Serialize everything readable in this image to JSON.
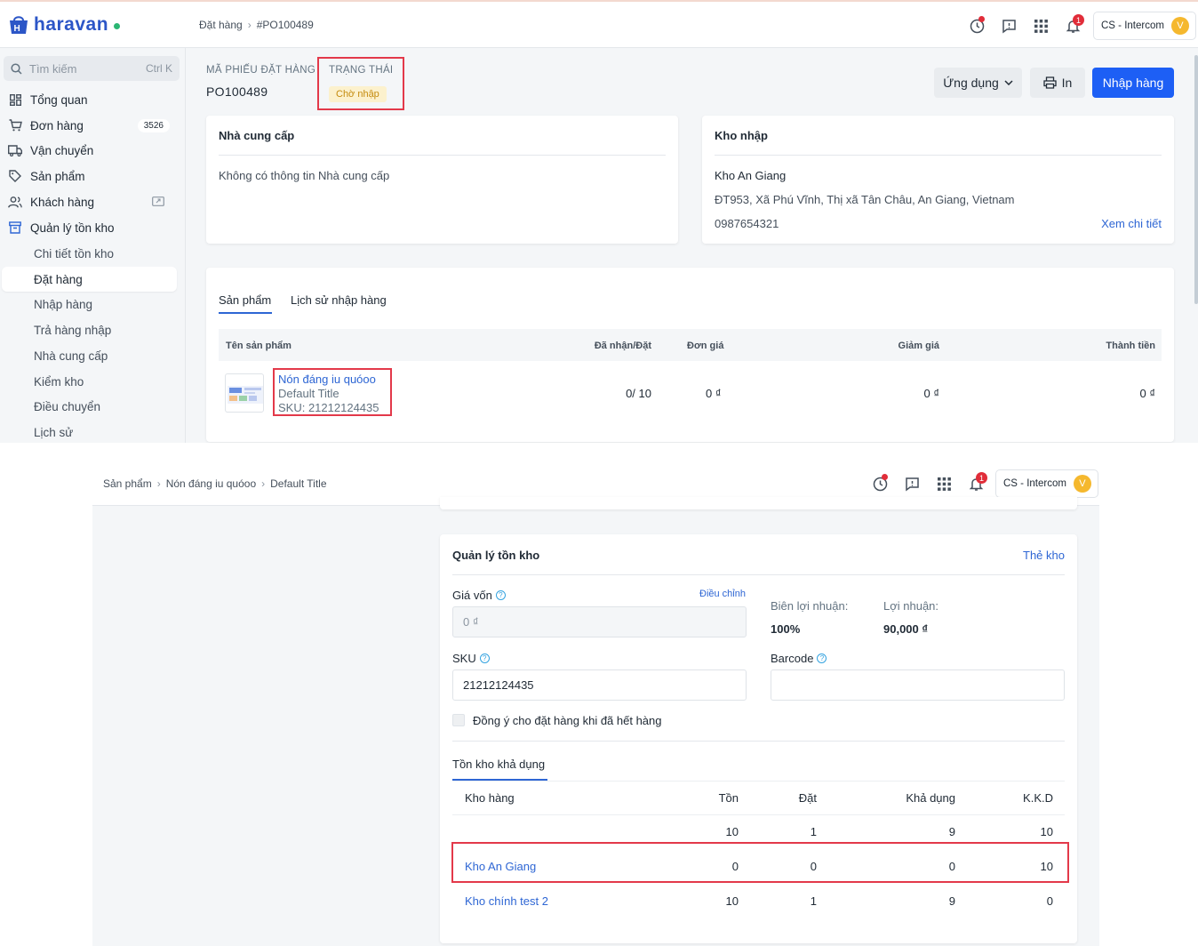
{
  "brand": {
    "name": "haravan",
    "accent": "#2c56c7",
    "status_color": "#2bb673"
  },
  "header": {
    "breadcrumb": [
      "Đặt hàng",
      "#PO100489"
    ],
    "account": "CS - Intercom",
    "avatar_letter": "V",
    "notification_count": "1"
  },
  "sidebar": {
    "search_placeholder": "Tìm kiếm",
    "search_shortcut": "Ctrl K",
    "items": [
      {
        "label": "Tổng quan",
        "icon": "dashboard-icon"
      },
      {
        "label": "Đơn hàng",
        "icon": "cart-icon",
        "count": "3526"
      },
      {
        "label": "Vận chuyển",
        "icon": "truck-icon"
      },
      {
        "label": "Sản phẩm",
        "icon": "tag-icon"
      },
      {
        "label": "Khách hàng",
        "icon": "users-icon"
      },
      {
        "label": "Quản lý tồn kho",
        "icon": "box-icon"
      }
    ],
    "subitems": [
      "Chi tiết tồn kho",
      "Đặt hàng",
      "Nhập hàng",
      "Trả hàng nhập",
      "Nhà cung cấp",
      "Kiểm kho",
      "Điều chuyển",
      "Lịch sử"
    ]
  },
  "order": {
    "code_label": "MÃ PHIẾU ĐẶT HÀNG",
    "code": "PO100489",
    "status_label": "TRẠNG THÁI",
    "status": "Chờ nhập"
  },
  "actions": {
    "apps": "Ứng dụng",
    "print": "In",
    "import": "Nhập hàng"
  },
  "supplier": {
    "title": "Nhà cung cấp",
    "empty": "Không có thông tin Nhà cung cấp"
  },
  "warehouse": {
    "title": "Kho nhập",
    "name": "Kho An Giang",
    "address": "ĐT953, Xã Phú Vĩnh, Thị xã Tân Châu, An Giang, Vietnam",
    "phone": "0987654321",
    "detail_link": "Xem chi tiết"
  },
  "tabs": [
    "Sản phẩm",
    "Lịch sử nhập hàng"
  ],
  "product_table": {
    "headers": [
      "Tên sản phẩm",
      "Đã nhận/Đặt",
      "Đơn giá",
      "Giảm giá",
      "Thành tiền"
    ],
    "row": {
      "name": "Nón đáng iu quóoo",
      "variant": "Default Title",
      "sku": "SKU: 21212124435",
      "received": "0/ 10",
      "price": "0 ₫",
      "discount": "0 ₫",
      "total": "0 ₫"
    }
  },
  "product_page": {
    "breadcrumb": [
      "Sản phẩm",
      "Nón đáng iu quóoo",
      "Default Title"
    ],
    "account": "CS - Intercom",
    "avatar_letter": "V",
    "notification_count": "1",
    "inventory": {
      "title": "Quản lý tồn kho",
      "stock_card": "Thẻ kho",
      "cost_label": "Giá vốn",
      "adjust": "Điều chỉnh",
      "cost_value": "0 ₫",
      "margin_label": "Biên lợi nhuận:",
      "margin_value": "100%",
      "profit_label": "Lợi nhuận:",
      "profit_value": "90,000 ₫",
      "sku_label": "SKU",
      "sku_value": "21212124435",
      "barcode_label": "Barcode",
      "barcode_value": "",
      "allow_backorder": "Đồng ý cho đặt hàng khi đã hết hàng",
      "tab": "Tồn kho khả dụng",
      "headers": [
        "Kho hàng",
        "Tồn",
        "Đặt",
        "Khả dụng",
        "K.K.D"
      ],
      "total_row": [
        "",
        "10",
        "1",
        "9",
        "10"
      ],
      "rows": [
        [
          "Kho An Giang",
          "0",
          "0",
          "0",
          "10"
        ],
        [
          "Kho chính test 2",
          "10",
          "1",
          "9",
          "0"
        ]
      ]
    }
  }
}
